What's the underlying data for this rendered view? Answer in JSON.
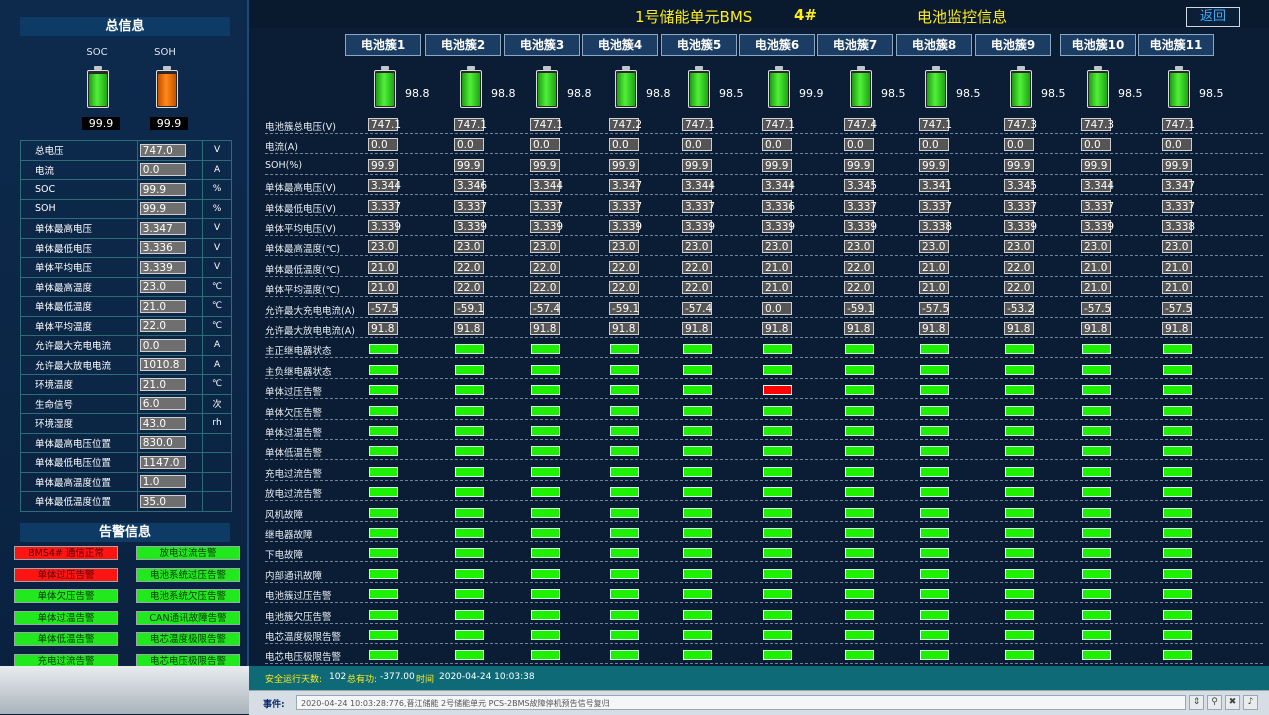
{
  "summary": {
    "title": "总信息",
    "soc_label": "SOC",
    "soh_label": "SOH",
    "soc_value": "99.9",
    "soh_value": "99.9",
    "colors": {
      "soc": "#3be82b",
      "soh": "#ff7a12"
    },
    "rows": [
      {
        "label": "总电压",
        "value": "747.0",
        "unit": "V"
      },
      {
        "label": "电流",
        "value": "0.0",
        "unit": "A"
      },
      {
        "label": "SOC",
        "value": "99.9",
        "unit": "%"
      },
      {
        "label": "SOH",
        "value": "99.9",
        "unit": "%"
      },
      {
        "label": "单体最高电压",
        "value": "3.347",
        "unit": "V"
      },
      {
        "label": "单体最低电压",
        "value": "3.336",
        "unit": "V"
      },
      {
        "label": "单体平均电压",
        "value": "3.339",
        "unit": "V"
      },
      {
        "label": "单体最高温度",
        "value": "23.0",
        "unit": "℃"
      },
      {
        "label": "单体最低温度",
        "value": "21.0",
        "unit": "℃"
      },
      {
        "label": "单体平均温度",
        "value": "22.0",
        "unit": "℃"
      },
      {
        "label": "允许最大充电电流",
        "value": "0.0",
        "unit": "A"
      },
      {
        "label": "允许最大放电电流",
        "value": "1010.8",
        "unit": "A"
      },
      {
        "label": "环境温度",
        "value": "21.0",
        "unit": "℃"
      },
      {
        "label": "生命信号",
        "value": "6.0",
        "unit": "次"
      },
      {
        "label": "环境湿度",
        "value": "43.0",
        "unit": "rh"
      },
      {
        "label": "单体最高电压位置",
        "value": "830.0",
        "unit": ""
      },
      {
        "label": "单体最低电压位置",
        "value": "1147.0",
        "unit": ""
      },
      {
        "label": "单体最高温度位置",
        "value": "1.0",
        "unit": ""
      },
      {
        "label": "单体最低温度位置",
        "value": "35.0",
        "unit": ""
      }
    ]
  },
  "alarms": {
    "title": "告警信息",
    "items": [
      {
        "label": "BMS4# 通信正常",
        "state": "red"
      },
      {
        "label": "放电过流告警",
        "state": "green"
      },
      {
        "label": "单体过压告警",
        "state": "red"
      },
      {
        "label": "电池系统过压告警",
        "state": "green"
      },
      {
        "label": "单体欠压告警",
        "state": "green"
      },
      {
        "label": "电池系统欠压告警",
        "state": "green"
      },
      {
        "label": "单体过温告警",
        "state": "green"
      },
      {
        "label": "CAN通讯故障告警",
        "state": "green"
      },
      {
        "label": "单体低温告警",
        "state": "green"
      },
      {
        "label": "电芯温度极限告警",
        "state": "green"
      },
      {
        "label": "充电过流告警",
        "state": "green"
      },
      {
        "label": "电芯电压极限告警",
        "state": "green"
      }
    ]
  },
  "header": {
    "title_unit": "1号储能单元BMS",
    "title_num": "4#",
    "title_page": "电池监控信息",
    "back_label": "返回"
  },
  "clusters": {
    "tabs": [
      "电池簇1",
      "电池簇2",
      "电池簇3",
      "电池簇4",
      "电池簇5",
      "电池簇6",
      "电池簇7",
      "电池簇8",
      "电池簇9",
      "电池簇10",
      "电池簇11"
    ],
    "soc_values": [
      "98.8",
      "98.8",
      "98.8",
      "98.8",
      "98.5",
      "99.9",
      "98.5",
      "98.5",
      "98.5",
      "98.5",
      "98.5"
    ],
    "value_rows": [
      {
        "label": "电池簇总电压(V)",
        "values": [
          "747.1",
          "747.1",
          "747.1",
          "747.2",
          "747.1",
          "747.1",
          "747.4",
          "747.1",
          "747.3",
          "747.3",
          "747.1"
        ]
      },
      {
        "label": "电流(A)",
        "values": [
          "0.0",
          "0.0",
          "0.0",
          "0.0",
          "0.0",
          "0.0",
          "0.0",
          "0.0",
          "0.0",
          "0.0",
          "0.0"
        ]
      },
      {
        "label": "SOH(%)",
        "values": [
          "99.9",
          "99.9",
          "99.9",
          "99.9",
          "99.9",
          "99.9",
          "99.9",
          "99.9",
          "99.9",
          "99.9",
          "99.9"
        ]
      },
      {
        "label": "单体最高电压(V)",
        "values": [
          "3.344",
          "3.346",
          "3.344",
          "3.347",
          "3.344",
          "3.344",
          "3.345",
          "3.341",
          "3.345",
          "3.344",
          "3.347"
        ]
      },
      {
        "label": "单体最低电压(V)",
        "values": [
          "3.337",
          "3.337",
          "3.337",
          "3.337",
          "3.337",
          "3.336",
          "3.337",
          "3.337",
          "3.337",
          "3.337",
          "3.337"
        ]
      },
      {
        "label": "单体平均电压(V)",
        "values": [
          "3.339",
          "3.339",
          "3.339",
          "3.339",
          "3.339",
          "3.339",
          "3.339",
          "3.338",
          "3.339",
          "3.339",
          "3.338"
        ]
      },
      {
        "label": "单体最高温度(℃)",
        "values": [
          "23.0",
          "23.0",
          "23.0",
          "23.0",
          "23.0",
          "23.0",
          "23.0",
          "23.0",
          "23.0",
          "23.0",
          "23.0"
        ]
      },
      {
        "label": "单体最低温度(℃)",
        "values": [
          "21.0",
          "22.0",
          "22.0",
          "22.0",
          "22.0",
          "21.0",
          "22.0",
          "21.0",
          "22.0",
          "21.0",
          "21.0"
        ]
      },
      {
        "label": "单体平均温度(℃)",
        "values": [
          "21.0",
          "22.0",
          "22.0",
          "22.0",
          "22.0",
          "21.0",
          "22.0",
          "21.0",
          "22.0",
          "21.0",
          "21.0"
        ]
      },
      {
        "label": "允许最大充电电流(A)",
        "values": [
          "-57.5",
          "-59.1",
          "-57.4",
          "-59.1",
          "-57.4",
          "0.0",
          "-59.1",
          "-57.5",
          "-53.2",
          "-57.5",
          "-57.5"
        ]
      },
      {
        "label": "允许最大放电电流(A)",
        "values": [
          "91.8",
          "91.8",
          "91.8",
          "91.8",
          "91.8",
          "91.8",
          "91.8",
          "91.8",
          "91.8",
          "91.8",
          "91.8"
        ]
      }
    ],
    "status_rows": [
      {
        "label": "主正继电器状态",
        "alarm_index": -1
      },
      {
        "label": "主负继电器状态",
        "alarm_index": -1
      },
      {
        "label": "单体过压告警",
        "alarm_index": 5
      },
      {
        "label": "单体欠压告警",
        "alarm_index": -1
      },
      {
        "label": "单体过温告警",
        "alarm_index": -1
      },
      {
        "label": "单体低温告警",
        "alarm_index": -1
      },
      {
        "label": "充电过流告警",
        "alarm_index": -1
      },
      {
        "label": "放电过流告警",
        "alarm_index": -1
      },
      {
        "label": "风机故障",
        "alarm_index": -1
      },
      {
        "label": "继电器故障",
        "alarm_index": -1
      },
      {
        "label": "下电故障",
        "alarm_index": -1
      },
      {
        "label": "内部通讯故障",
        "alarm_index": -1
      },
      {
        "label": "电池簇过压告警",
        "alarm_index": -1
      },
      {
        "label": "电池簇欠压告警",
        "alarm_index": -1
      },
      {
        "label": "电芯温度极限告警",
        "alarm_index": -1
      },
      {
        "label": "电芯电压极限告警",
        "alarm_index": -1
      }
    ],
    "colors": {
      "ok": "#1ef000",
      "alarm": "#ff0000"
    }
  },
  "statusbar": {
    "days_label": "安全运行天数:",
    "days_value": "102",
    "power_label": "总有功:",
    "power_value": "-377.00",
    "time_label": "时间",
    "time_value": "2020-04-24 10:03:38"
  },
  "eventbar": {
    "label": "事件:",
    "text": "2020-04-24 10:03:28:776,晋江储能 2号储能单元 PCS-2BMS故障停机预告信号复归"
  }
}
